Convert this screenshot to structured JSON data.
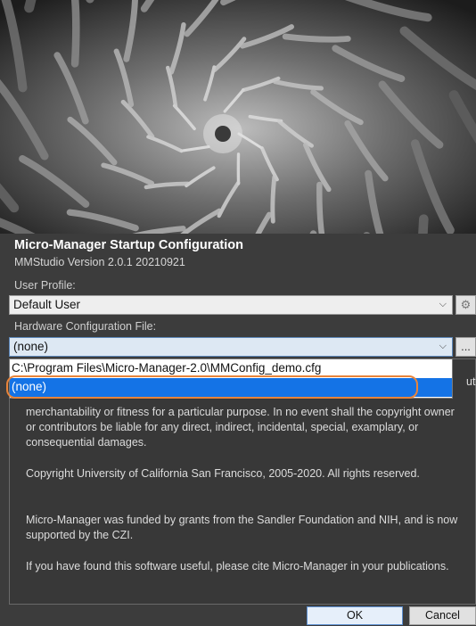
{
  "window": {
    "title": "Micro-Manager Startup Configuration",
    "version": "MMStudio Version 2.0.1 20210921"
  },
  "profile": {
    "label": "User Profile:",
    "value": "Default User",
    "settings_icon": "gear-icon"
  },
  "hardware": {
    "label": "Hardware Configuration File:",
    "value": "(none)",
    "browse_label": "...",
    "options": [
      "C:\\Program Files\\Micro-Manager-2.0\\MMConfig_demo.cfg",
      "(none)"
    ]
  },
  "info": {
    "overflow_tail": "ut",
    "paragraphs": [
      "merchantability or fitness for a particular purpose. In no event shall the copyright owner or contributors be liable for any direct, indirect, incidental, special, examplary, or consequential damages.",
      "Copyright University of California San Francisco, 2005-2020. All rights reserved.",
      "Micro-Manager was funded by grants from the Sandler Foundation and NIH, and is now supported by the CZI.",
      "If you have found this software useful, please cite Micro-Manager in your publications."
    ]
  },
  "buttons": {
    "ok": "OK",
    "cancel": "Cancel"
  },
  "colors": {
    "selection": "#1473e6",
    "highlight_ring": "#e8843a",
    "background": "#3c3c3c"
  }
}
